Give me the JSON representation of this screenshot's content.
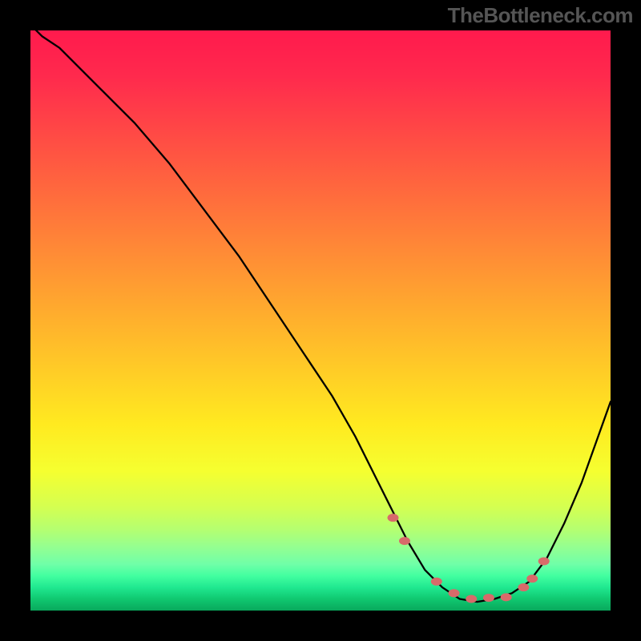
{
  "watermark": "TheBottleneck.com",
  "chart_data": {
    "type": "line",
    "title": "",
    "xlabel": "",
    "ylabel": "",
    "xlim": [
      0,
      100
    ],
    "ylim": [
      0,
      100
    ],
    "series": [
      {
        "name": "bottleneck-curve",
        "x": [
          0,
          2,
          5,
          8,
          12,
          18,
          24,
          30,
          36,
          42,
          48,
          52,
          56,
          60,
          62,
          65,
          68,
          71,
          74,
          77,
          80,
          83,
          86,
          89,
          92,
          95,
          100
        ],
        "y": [
          101,
          99,
          97,
          94,
          90,
          84,
          77,
          69,
          61,
          52,
          43,
          37,
          30,
          22,
          18,
          12,
          7,
          4,
          2,
          1.5,
          2,
          3,
          5,
          9,
          15,
          22,
          36
        ]
      }
    ],
    "markers": {
      "color": "#d86a6a",
      "x": [
        62.5,
        64.5,
        70,
        73,
        76,
        79,
        82,
        85,
        86.5,
        88.5
      ],
      "y": [
        16,
        12,
        5,
        3,
        2,
        2.2,
        2.3,
        4,
        5.5,
        8.5
      ]
    },
    "colors": {
      "curve": "#000000",
      "marker": "#d86a6a",
      "frame": "#000000"
    }
  }
}
